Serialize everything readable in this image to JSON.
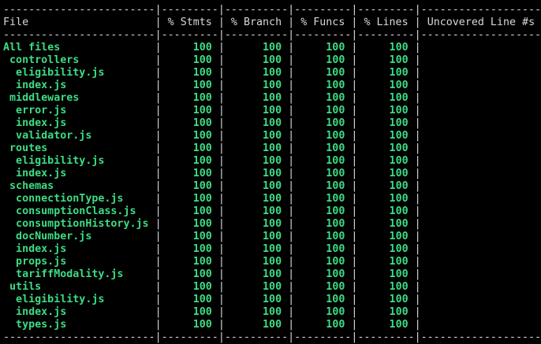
{
  "colors": {
    "background": "#000000",
    "text": "#d8d8d8",
    "covered": "#3ddc84"
  },
  "header": {
    "file": "File",
    "stmts": "% Stmts",
    "branch": "% Branch",
    "funcs": "% Funcs",
    "lines": "% Lines",
    "uncovered": "Uncovered Line #s"
  },
  "rows": [
    {
      "name": "All files",
      "depth": 0,
      "stmts": "100",
      "branch": "100",
      "funcs": "100",
      "lines": "100",
      "uncovered": ""
    },
    {
      "name": "controllers",
      "depth": 1,
      "stmts": "100",
      "branch": "100",
      "funcs": "100",
      "lines": "100",
      "uncovered": ""
    },
    {
      "name": "eligibility.js",
      "depth": 2,
      "stmts": "100",
      "branch": "100",
      "funcs": "100",
      "lines": "100",
      "uncovered": ""
    },
    {
      "name": "index.js",
      "depth": 2,
      "stmts": "100",
      "branch": "100",
      "funcs": "100",
      "lines": "100",
      "uncovered": ""
    },
    {
      "name": "middlewares",
      "depth": 1,
      "stmts": "100",
      "branch": "100",
      "funcs": "100",
      "lines": "100",
      "uncovered": ""
    },
    {
      "name": "error.js",
      "depth": 2,
      "stmts": "100",
      "branch": "100",
      "funcs": "100",
      "lines": "100",
      "uncovered": ""
    },
    {
      "name": "index.js",
      "depth": 2,
      "stmts": "100",
      "branch": "100",
      "funcs": "100",
      "lines": "100",
      "uncovered": ""
    },
    {
      "name": "validator.js",
      "depth": 2,
      "stmts": "100",
      "branch": "100",
      "funcs": "100",
      "lines": "100",
      "uncovered": ""
    },
    {
      "name": "routes",
      "depth": 1,
      "stmts": "100",
      "branch": "100",
      "funcs": "100",
      "lines": "100",
      "uncovered": ""
    },
    {
      "name": "eligibility.js",
      "depth": 2,
      "stmts": "100",
      "branch": "100",
      "funcs": "100",
      "lines": "100",
      "uncovered": ""
    },
    {
      "name": "index.js",
      "depth": 2,
      "stmts": "100",
      "branch": "100",
      "funcs": "100",
      "lines": "100",
      "uncovered": ""
    },
    {
      "name": "schemas",
      "depth": 1,
      "stmts": "100",
      "branch": "100",
      "funcs": "100",
      "lines": "100",
      "uncovered": ""
    },
    {
      "name": "connectionType.js",
      "depth": 2,
      "stmts": "100",
      "branch": "100",
      "funcs": "100",
      "lines": "100",
      "uncovered": ""
    },
    {
      "name": "consumptionClass.js",
      "depth": 2,
      "stmts": "100",
      "branch": "100",
      "funcs": "100",
      "lines": "100",
      "uncovered": ""
    },
    {
      "name": "consumptionHistory.js",
      "depth": 2,
      "stmts": "100",
      "branch": "100",
      "funcs": "100",
      "lines": "100",
      "uncovered": ""
    },
    {
      "name": "docNumber.js",
      "depth": 2,
      "stmts": "100",
      "branch": "100",
      "funcs": "100",
      "lines": "100",
      "uncovered": ""
    },
    {
      "name": "index.js",
      "depth": 2,
      "stmts": "100",
      "branch": "100",
      "funcs": "100",
      "lines": "100",
      "uncovered": ""
    },
    {
      "name": "props.js",
      "depth": 2,
      "stmts": "100",
      "branch": "100",
      "funcs": "100",
      "lines": "100",
      "uncovered": ""
    },
    {
      "name": "tariffModality.js",
      "depth": 2,
      "stmts": "100",
      "branch": "100",
      "funcs": "100",
      "lines": "100",
      "uncovered": ""
    },
    {
      "name": "utils",
      "depth": 1,
      "stmts": "100",
      "branch": "100",
      "funcs": "100",
      "lines": "100",
      "uncovered": ""
    },
    {
      "name": "eligibility.js",
      "depth": 2,
      "stmts": "100",
      "branch": "100",
      "funcs": "100",
      "lines": "100",
      "uncovered": ""
    },
    {
      "name": "index.js",
      "depth": 2,
      "stmts": "100",
      "branch": "100",
      "funcs": "100",
      "lines": "100",
      "uncovered": ""
    },
    {
      "name": "types.js",
      "depth": 2,
      "stmts": "100",
      "branch": "100",
      "funcs": "100",
      "lines": "100",
      "uncovered": ""
    }
  ]
}
